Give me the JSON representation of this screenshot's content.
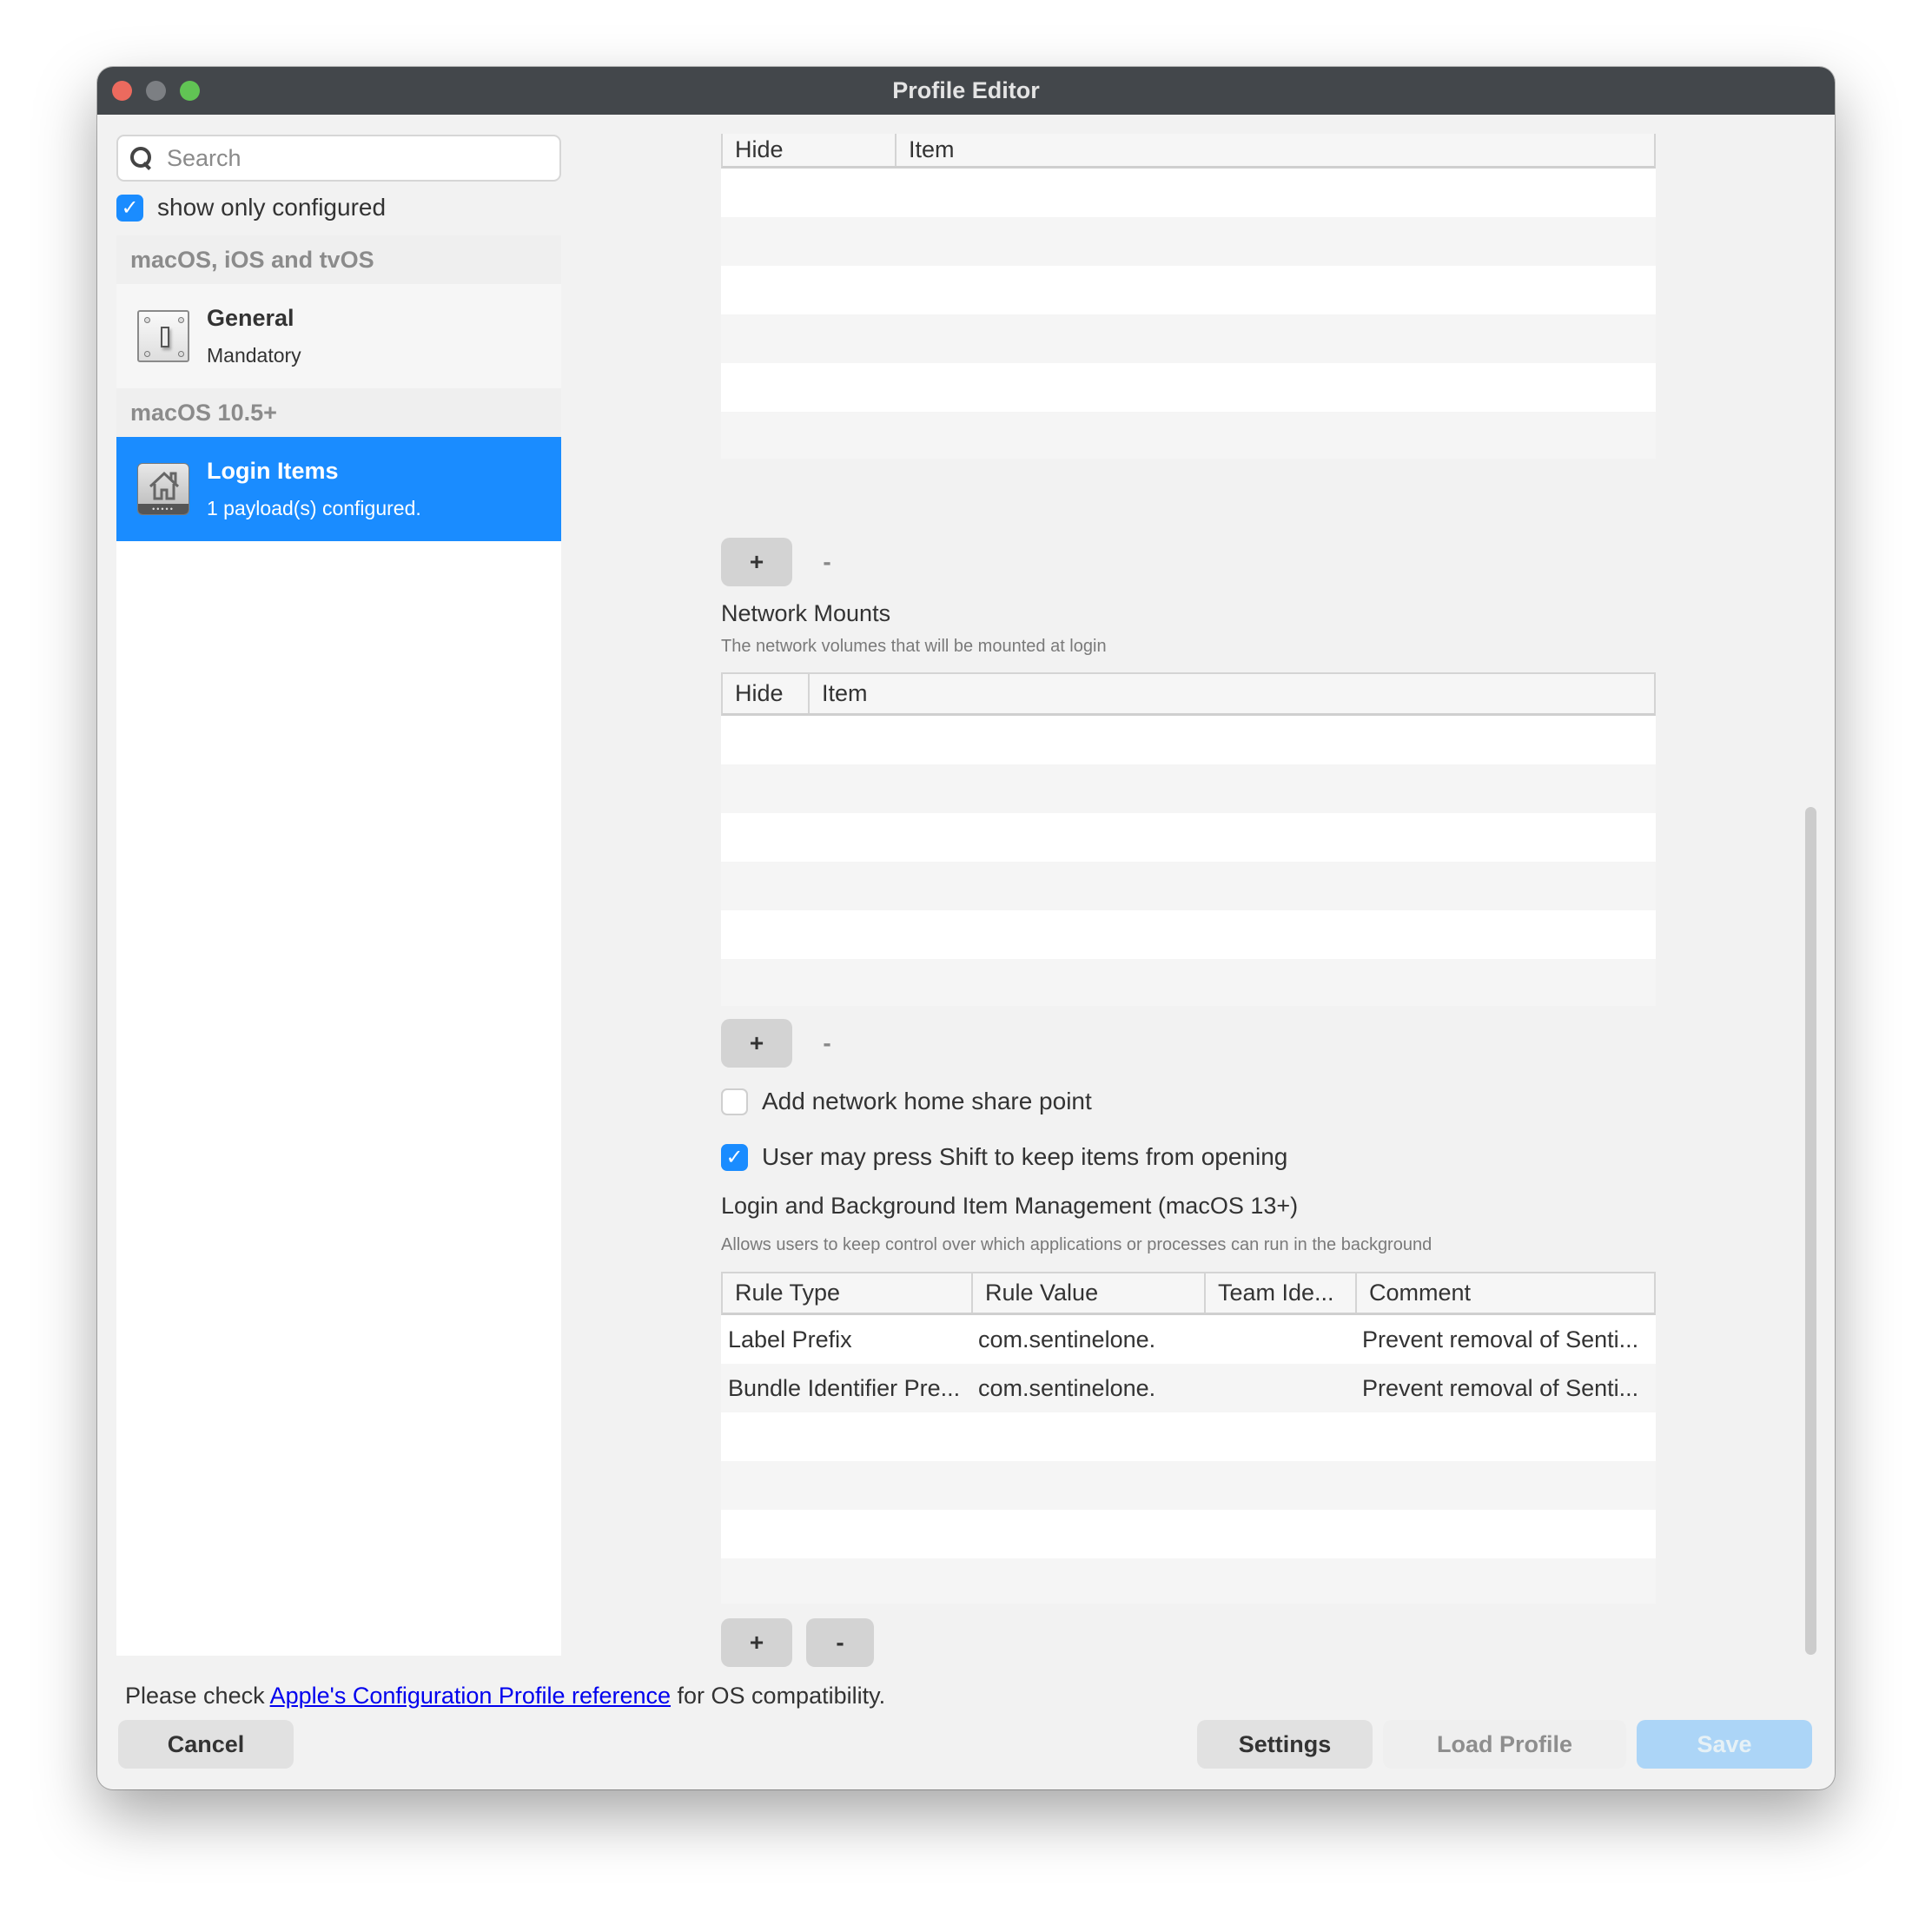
{
  "window": {
    "title": "Profile Editor"
  },
  "sidebar": {
    "search_placeholder": "Search",
    "search_value": "",
    "show_only_configured": {
      "label": "show only configured",
      "checked": true
    },
    "groups": [
      {
        "header": "macOS, iOS and tvOS",
        "items": [
          {
            "title": "General",
            "subtitle": "Mandatory",
            "icon": "switch-icon",
            "selected": false
          }
        ]
      },
      {
        "header": "macOS 10.5+",
        "items": [
          {
            "title": "Login Items",
            "subtitle": "1 payload(s) configured.",
            "icon": "home-icon",
            "selected": true
          }
        ]
      }
    ]
  },
  "content": {
    "login_items_table": {
      "columns": [
        "Hide",
        "Item"
      ],
      "rows": [],
      "add_label": "+",
      "remove_label": "-"
    },
    "network_mounts": {
      "title": "Network Mounts",
      "description": "The network volumes that will be mounted at login",
      "columns": [
        "Hide",
        "Item"
      ],
      "rows": [],
      "add_label": "+",
      "remove_label": "-"
    },
    "add_network_home_share": {
      "label": "Add network home share point",
      "checked": false
    },
    "shift_to_keep": {
      "label": "User may press Shift to keep items from opening",
      "checked": true
    },
    "background_items": {
      "title": "Login and Background Item Management (macOS 13+)",
      "description": "Allows users to keep control over which applications or processes can run in the background",
      "columns": [
        "Rule Type",
        "Rule Value",
        "Team Ide...",
        "Comment"
      ],
      "rows": [
        [
          "Label Prefix",
          "com.sentinelone.",
          "",
          "Prevent removal of Senti..."
        ],
        [
          "Bundle Identifier Pre...",
          "com.sentinelone.",
          "",
          "Prevent removal of Senti..."
        ]
      ],
      "add_label": "+",
      "remove_label": "-"
    }
  },
  "footer": {
    "note_prefix": "Please check ",
    "note_link": "Apple's Configuration Profile reference",
    "note_suffix": " for OS compatibility.",
    "cancel_label": "Cancel",
    "settings_label": "Settings",
    "load_profile_label": "Load Profile",
    "save_label": "Save"
  },
  "colors": {
    "accent": "#1a8cff",
    "titlebar": "#43474b",
    "link": "#0000ee",
    "save_disabled": "#acd5f7"
  }
}
